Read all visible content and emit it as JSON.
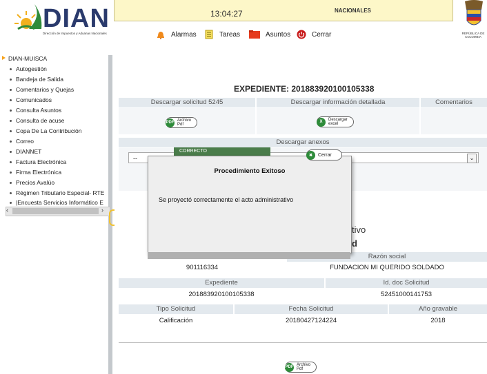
{
  "header": {
    "logo_text": "DIAN",
    "logo_subtitle": "Dirección de Impuestos y Aduanas Nacionales",
    "clock": "13:04:27",
    "banner_text": "NACIONALES",
    "country_caption": "REPÚBLICA DE COLOMBIA",
    "toolbar": [
      {
        "label": "Alarmas",
        "icon": "bell-icon"
      },
      {
        "label": "Tareas",
        "icon": "notepad-icon"
      },
      {
        "label": "Asuntos",
        "icon": "folder-icon"
      },
      {
        "label": "Cerrar",
        "icon": "power-icon"
      }
    ]
  },
  "sidebar": {
    "root": "DIAN-MUISCA",
    "items": [
      "Autogestión",
      "Bandeja de Salida",
      "Comentarios y Quejas",
      "Comunicados",
      "Consulta Asuntos",
      "Consulta de acuse",
      "Copa De La Contribución",
      "Correo",
      "DIANNET",
      "Factura Electrónica",
      "Firma Electrónica",
      "Precios Avalúo",
      "Régimen Tributario Especial- RTE",
      "|Encuesta Servicios Informático E"
    ]
  },
  "main": {
    "title": "EXPEDIENTE: 201883920100105338",
    "top_headers": [
      "Descargar solicitud 5245",
      "Descargar información detallada",
      "Comentarios"
    ],
    "archivo_pdf_label": "Archivo\nPdf",
    "descargar_excel_label": "Descargar\nexcel",
    "descargar_anexos": "Descargar anexos",
    "select_value": "--",
    "partial_text_1": "tivo",
    "partial_text_2": "d",
    "razon_social_header": "Razón social",
    "nit_value": "901116334",
    "razon_social_value": "FUNDACION MI QUERIDO SOLDADO",
    "expediente_header": "Expediente",
    "id_doc_header": "Id. doc Solicitud",
    "expediente_value": "201883920100105338",
    "id_doc_value": "52451000141753",
    "tipo_header": "Tipo Solicitud",
    "fecha_header": "Fecha Solicitud",
    "anio_header": "Año gravable",
    "tipo_value": "Calificación",
    "fecha_value": "20180427124224",
    "anio_value": "2018",
    "bottom_archivo_label": "Archivo\nPdf"
  },
  "modal": {
    "tab_label": "CORRECTO",
    "close_label": "Cerrar",
    "title": "Procedimiento Exitoso",
    "message": "Se proyectó correctamente el acto administrativo"
  },
  "colors": {
    "header_bg": "#fdf7c8",
    "table_header_bg": "#e3e9ee",
    "brand_blue": "#2a3a6c",
    "success_green": "#4a7c4a"
  }
}
